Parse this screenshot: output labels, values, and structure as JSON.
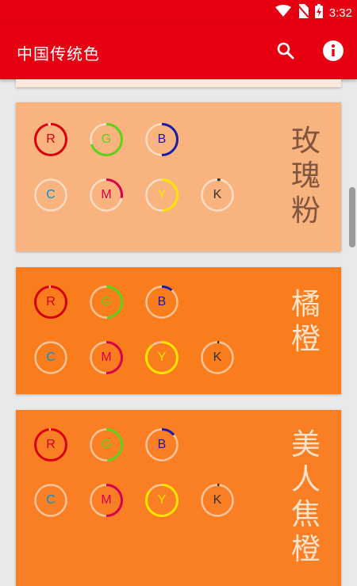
{
  "status_bar": {
    "time": "3:32",
    "icons": [
      "wifi-icon",
      "no-sim-icon",
      "battery-charging-icon"
    ]
  },
  "app_bar": {
    "title": "中国传统色",
    "actions": [
      {
        "icon": "search-icon",
        "label": ""
      },
      {
        "icon": "info-icon",
        "label": ""
      }
    ]
  },
  "colors": [
    {
      "name": "玫瑰粉",
      "bg": "#f8b37f",
      "text_color": "#805640",
      "channels": {
        "R": 0.97,
        "G": 0.7,
        "B": 0.5,
        "C": 0.0,
        "M": 0.28,
        "Y": 0.49,
        "K": 0.03
      }
    },
    {
      "name": "橘橙",
      "bg": "#f97d1c",
      "text_color": "#fde3cc",
      "channels": {
        "R": 0.98,
        "G": 0.49,
        "B": 0.11,
        "C": 0.0,
        "M": 0.5,
        "Y": 0.89,
        "K": 0.02
      }
    },
    {
      "name": "美人焦橙",
      "bg": "#fa7e23",
      "text_color": "#fde3cc",
      "channels": {
        "R": 0.98,
        "G": 0.49,
        "B": 0.14,
        "C": 0.0,
        "M": 0.5,
        "Y": 0.86,
        "K": 0.02
      }
    }
  ],
  "channel_colors": {
    "R": "#d7000f",
    "G": "#5bd319",
    "B": "#1a1aa8",
    "C": "#0093d6",
    "M": "#d6004f",
    "Y": "#ffe600",
    "K": "#333333"
  }
}
